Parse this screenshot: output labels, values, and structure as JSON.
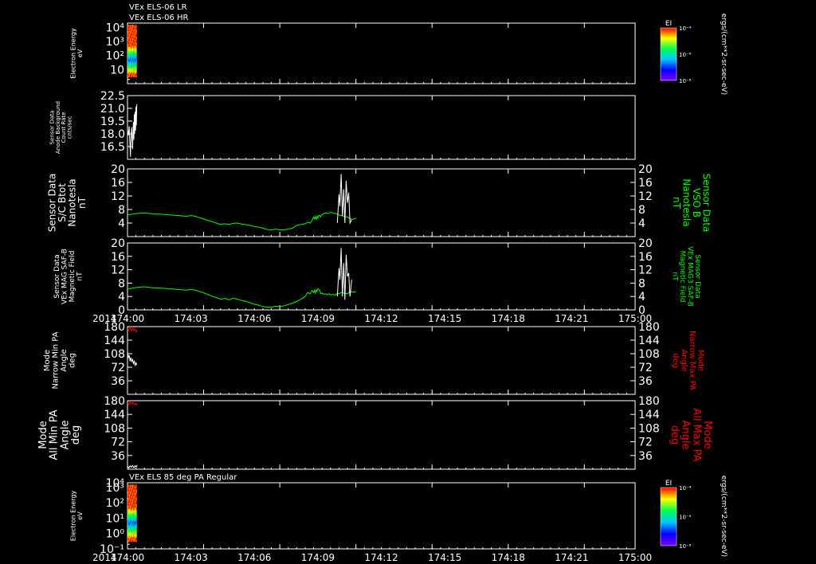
{
  "chart_data": [
    {
      "type": "heatmap",
      "titles": [
        "VEx ELS-06 LR",
        "VEx ELS-06 HR"
      ],
      "ylabel": [
        "Electron Energy",
        "eV"
      ],
      "yscale": "log",
      "ylim": [
        1,
        20000
      ],
      "yticks": [
        {
          "v": 10,
          "t": "10"
        },
        {
          "v": 100,
          "t": "10²"
        },
        {
          "v": 1000,
          "t": "10³"
        },
        {
          "v": 10000,
          "t": "10⁴"
        }
      ],
      "data_extent": {
        "x": [
          0.0,
          1.1
        ],
        "y": [
          3,
          15000
        ]
      },
      "colorbar": {
        "label": "EI",
        "ticks": [
          {
            "v": 0,
            "t": "10⁻⁴"
          },
          {
            "v": 0.5,
            "t": "10⁻⁶"
          },
          {
            "v": 1,
            "t": "10⁻⁸"
          }
        ],
        "unit": "ergs/(cm**2-sr-sec-eV)"
      }
    },
    {
      "type": "line",
      "ylabel": [
        "Sensor Data",
        "Anode Background",
        "Count Rate",
        "cnts/sec"
      ],
      "ylim": [
        15.0,
        22.5
      ],
      "yticks": [
        16.5,
        18.0,
        19.5,
        21.0,
        22.5
      ],
      "ytick_labels": [
        "16.5",
        "18.0",
        "19.5",
        "21.0",
        "22.5"
      ],
      "series": [
        {
          "color": "#ffffff",
          "x": [
            0.0,
            0.1,
            0.2,
            0.3,
            0.35,
            0.4,
            0.5,
            0.6,
            0.7,
            0.75,
            0.8,
            0.85,
            0.9,
            0.95,
            1.0,
            1.05,
            1.1
          ],
          "y": [
            18.5,
            17.8,
            18.9,
            16.5,
            15.3,
            17.2,
            18.8,
            16.2,
            19.4,
            17.3,
            20.3,
            18.0,
            20.6,
            18.4,
            21.2,
            19.0,
            21.5
          ]
        }
      ]
    },
    {
      "type": "line",
      "ylabel": [
        "Sensor Data",
        "S/C Btot",
        "Nanotesla",
        "nT"
      ],
      "right_label": [
        "Sensor Data",
        "VSO B",
        "Nanotesla",
        "nT"
      ],
      "ylim": [
        0,
        20
      ],
      "yticks": [
        4,
        8,
        12,
        16,
        20
      ],
      "series": [
        {
          "color": "#00ff00",
          "x": [
            0,
            1,
            2,
            3,
            4,
            5,
            6,
            7,
            7.5,
            8,
            8.5,
            9,
            9.5,
            10,
            10.5,
            11,
            11.5,
            12,
            12.5,
            13,
            13.5,
            14,
            14.5,
            15,
            15.5,
            16,
            16.5,
            17,
            17.5,
            18,
            18.5,
            19,
            19.5,
            20,
            20.5,
            21,
            21.3,
            21.6,
            21.8,
            22.0,
            22.1,
            22.2,
            22.3,
            22.4,
            22.5,
            22.6,
            22.7,
            22.8,
            22.9,
            23.0,
            23.2,
            23.4,
            23.6,
            23.8,
            24.0,
            24.3,
            24.6,
            24.8,
            25.0,
            25.3,
            25.6,
            26.0,
            26.3,
            26.6,
            27.0
          ],
          "y": [
            6.4,
            6.8,
            7.0,
            6.7,
            6.6,
            6.4,
            6.2,
            6.0,
            6.2,
            6.0,
            5.6,
            5.2,
            4.8,
            4.4,
            4.0,
            3.6,
            3.8,
            3.6,
            3.9,
            4.0,
            3.7,
            3.5,
            3.3,
            3.0,
            2.8,
            2.5,
            2.1,
            2.0,
            2.2,
            2.0,
            2.0,
            2.2,
            2.5,
            3.3,
            3.6,
            3.8,
            4.2,
            4.0,
            4.6,
            5.8,
            5.2,
            5.9,
            5.0,
            6.0,
            5.5,
            6.3,
            6.2,
            5.8,
            6.2,
            6.5,
            6.8,
            7.0,
            6.9,
            6.8,
            7.2,
            7.0,
            6.8,
            6.7,
            6.4,
            6.2,
            6.0,
            5.8,
            5.3,
            5.1,
            5.4
          ]
        },
        {
          "color": "#ffffff",
          "x": [
            24.8,
            25.0,
            25.1,
            25.25,
            25.4,
            25.55,
            25.7,
            25.85,
            26.0,
            26.15,
            26.3,
            26.5
          ],
          "y": [
            4.0,
            12.5,
            9.0,
            18.5,
            6.0,
            14.0,
            4.0,
            16.5,
            10.0,
            13.0,
            4.0,
            5.0
          ]
        }
      ]
    },
    {
      "type": "line",
      "ylabel": [
        "Sensor Data",
        "VEx MAG SAF-B",
        "Magnetic Field",
        "nT"
      ],
      "right_label": [
        "Sensor Data",
        "VEx MAG3 SAF-B",
        "Magnetic Field",
        "nT"
      ],
      "ylim": [
        0,
        20
      ],
      "yticks": [
        0,
        4,
        8,
        12,
        16,
        20
      ],
      "series": [
        {
          "color": "#00ff00",
          "x": [
            0,
            1,
            2,
            3,
            4,
            5,
            6,
            7,
            7.5,
            8,
            8.5,
            9,
            9.5,
            10,
            10.5,
            11,
            11.5,
            12,
            12.5,
            13,
            13.5,
            14,
            14.5,
            15,
            15.5,
            16,
            16.5,
            17,
            17.5,
            18,
            18.5,
            19,
            19.5,
            20,
            20.5,
            21,
            21.3,
            21.6,
            21.8,
            22.0,
            22.1,
            22.2,
            22.3,
            22.4,
            22.5,
            22.6,
            22.7,
            22.8,
            22.9,
            23.0,
            23.2,
            23.4,
            23.6,
            23.8,
            24.0,
            24.3,
            24.6,
            24.8,
            25.0,
            25.3,
            25.6,
            26.0,
            26.3,
            26.6,
            27.0
          ],
          "y": [
            6.2,
            6.7,
            6.9,
            6.6,
            6.5,
            6.3,
            6.1,
            5.9,
            6.1,
            5.9,
            5.5,
            5.1,
            4.6,
            4.1,
            3.7,
            3.2,
            3.4,
            3.0,
            3.5,
            3.2,
            2.8,
            2.6,
            2.1,
            1.7,
            1.4,
            1.0,
            0.8,
            0.8,
            1.1,
            1.0,
            1.2,
            1.6,
            2.0,
            2.5,
            3.2,
            4.0,
            5.2,
            4.8,
            5.8,
            5.2,
            5.9,
            5.0,
            6.0,
            5.5,
            6.3,
            6.2,
            5.8,
            5.2,
            4.8,
            5.0,
            4.7,
            4.8,
            4.6,
            4.8,
            4.5,
            4.6,
            4.4,
            5.0,
            4.8,
            5.2,
            5.0,
            4.8,
            5.5,
            5.3,
            5.4
          ]
        },
        {
          "color": "#ffffff",
          "x": [
            24.8,
            25.0,
            25.1,
            25.25,
            25.4,
            25.55,
            25.7,
            25.85,
            26.0,
            26.15,
            26.3,
            26.5
          ],
          "y": [
            4.0,
            12.5,
            9.0,
            18.5,
            4.0,
            14.0,
            3.0,
            16.5,
            10.0,
            11.0,
            4.0,
            9.0
          ]
        }
      ]
    },
    {
      "type": "line",
      "ylabel": [
        "Mode",
        "Narrow Min PA",
        "Angle",
        "deg"
      ],
      "right_label": [
        "Mode",
        "Narrow Max PA",
        "Angle",
        "deg"
      ],
      "ylim": [
        0,
        180
      ],
      "yticks": [
        36,
        72,
        108,
        144,
        180
      ],
      "series": [
        {
          "color": "#ff0000",
          "x": [
            0.0,
            0.15,
            0.3,
            0.45,
            0.6,
            0.75,
            0.9,
            1.05,
            1.15
          ],
          "y": [
            175,
            170,
            178,
            168,
            176,
            170,
            174,
            166,
            171
          ]
        },
        {
          "color": "#ffffff",
          "x": [
            0.0,
            0.1,
            0.2,
            0.3,
            0.4,
            0.5,
            0.6,
            0.7,
            0.8,
            0.9,
            1.0,
            1.1
          ],
          "y": [
            112,
            98,
            104,
            88,
            98,
            86,
            94,
            82,
            88,
            76,
            84,
            78
          ]
        }
      ]
    },
    {
      "type": "line",
      "ylabel": [
        "Mode",
        "All Min PA",
        "Angle",
        "deg"
      ],
      "right_label": [
        "Mode",
        "All Max PA",
        "Angle",
        "deg"
      ],
      "ylim": [
        0,
        180
      ],
      "yticks": [
        36,
        72,
        108,
        144,
        180
      ],
      "series": [
        {
          "color": "#ff0000",
          "x": [
            0.0,
            0.15,
            0.3,
            0.45,
            0.6,
            0.75,
            0.9,
            1.05,
            1.15
          ],
          "y": [
            175,
            170,
            177,
            172,
            176,
            170,
            174,
            168,
            172
          ]
        },
        {
          "color": "#ffffff",
          "x": [
            0.0,
            0.15,
            0.3,
            0.45,
            0.6,
            0.75,
            0.9,
            1.05,
            1.15
          ],
          "y": [
            8,
            3,
            9,
            5,
            10,
            4,
            9,
            6,
            11
          ]
        }
      ]
    },
    {
      "type": "heatmap",
      "titles": [
        "VEx ELS 85 deg PA Regular"
      ],
      "ylabel": [
        "Electron Energy",
        "eV"
      ],
      "yscale": "log",
      "ylim": [
        1,
        20000
      ],
      "yticks": [
        {
          "v": 1,
          "t": "10⁻¹"
        },
        {
          "v": 10,
          "t": "10⁰"
        },
        {
          "v": 100,
          "t": "10¹"
        },
        {
          "v": 1000,
          "t": "10²"
        },
        {
          "v": 10000,
          "t": "10³"
        },
        {
          "v": 20000,
          "t": "10⁴"
        }
      ],
      "data_extent": {
        "x": [
          0.0,
          1.1
        ],
        "y": [
          3,
          15000
        ]
      },
      "colorbar": {
        "label": "EI",
        "ticks": [
          {
            "v": 0,
            "t": "10⁻⁴"
          },
          {
            "v": 0.5,
            "t": "10⁻⁶"
          },
          {
            "v": 1,
            "t": "10⁻⁸"
          }
        ],
        "unit": "ergs/(cm**2-sr-sec-eV)"
      }
    }
  ],
  "xaxis": {
    "xlim": [
      0,
      60
    ],
    "ticks": [
      0,
      9,
      18,
      27,
      36,
      45,
      54,
      60
    ],
    "labels": [
      "174:00",
      "174:03",
      "174:06",
      "174:09",
      "174:12",
      "174:15",
      "174:18",
      "174:21",
      "175:00"
    ],
    "label_values": [
      0,
      3,
      6,
      9,
      12,
      15,
      18,
      21,
      24
    ],
    "year": "2014"
  }
}
